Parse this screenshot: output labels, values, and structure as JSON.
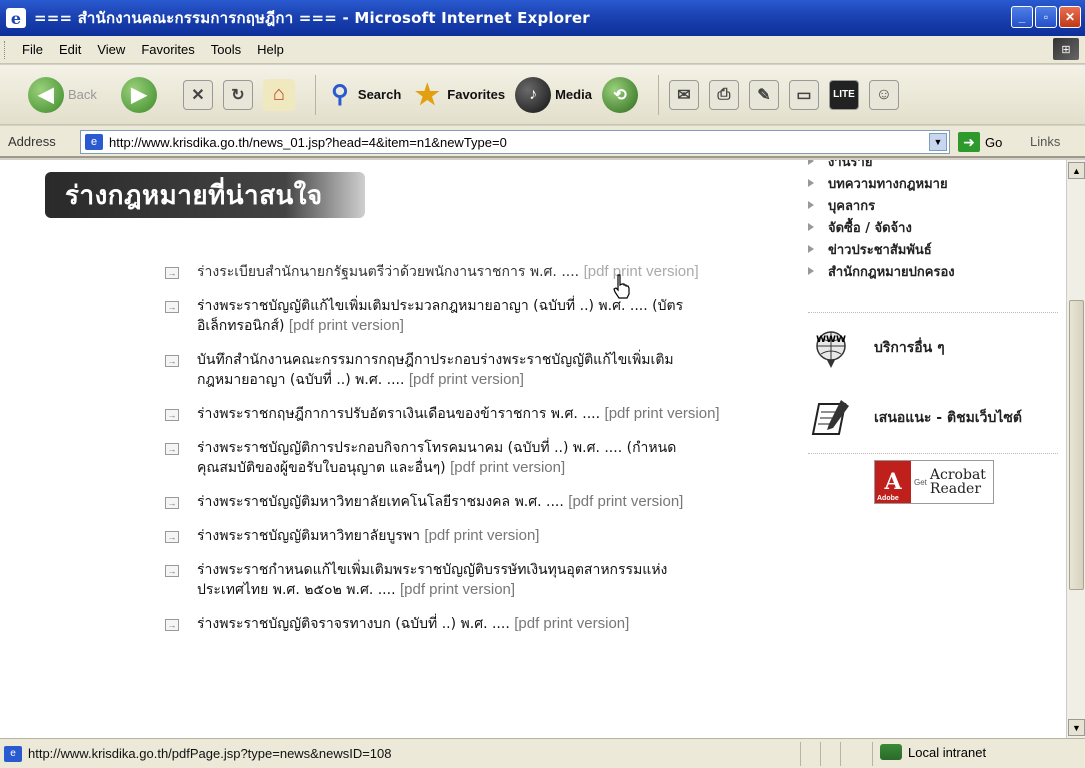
{
  "window": {
    "title": "=== สำนักงานคณะกรรมการกฤษฎีกา === - Microsoft Internet Explorer",
    "minimize": "_",
    "maximize": "▫",
    "close": "✕"
  },
  "menu": [
    "File",
    "Edit",
    "View",
    "Favorites",
    "Tools",
    "Help"
  ],
  "toolbar": {
    "back": "Back",
    "search": "Search",
    "favorites": "Favorites",
    "media": "Media"
  },
  "address": {
    "label": "Address",
    "url": "http://www.krisdika.go.th/news_01.jsp?head=4&item=n1&newType=0",
    "go": "Go",
    "links": "Links"
  },
  "page": {
    "heading": "ร่างกฎหมายที่น่าสนใจ",
    "articles": [
      {
        "text": "ร่างระเบียบสำนักนายกรัฐมนตรีว่าด้วยพนักงานราชการ พ.ศ. ....",
        "pdf": "[pdf print version]"
      },
      {
        "text": "ร่างพระราชบัญญัติแก้ไขเพิ่มเติมประมวลกฎหมายอาญา (ฉบับที่ ..) พ.ศ. .... (บัตรอิเล็กทรอนิกส์)",
        "pdf": "[pdf print version]"
      },
      {
        "text": "บันทึกสำนักงานคณะกรรมการกฤษฎีกาประกอบร่างพระราชบัญญัติแก้ไขเพิ่มเติมกฎหมายอาญา (ฉบับที่ ..) พ.ศ. ....",
        "pdf": "[pdf print version]"
      },
      {
        "text": "ร่างพระราชกฤษฎีกาการปรับอัตราเงินเดือนของข้าราชการ พ.ศ. ....",
        "pdf": "[pdf print version]"
      },
      {
        "text": "ร่างพระราชบัญญัติการประกอบกิจการโทรคมนาคม (ฉบับที่ ..) พ.ศ. .... (กำหนดคุณสมบัติของผู้ขอรับใบอนุญาต และอื่นๆ)",
        "pdf": "[pdf print version]"
      },
      {
        "text": "ร่างพระราชบัญญัติมหาวิทยาลัยเทคโนโลยีราชมงคล พ.ศ. ....",
        "pdf": "[pdf print version]"
      },
      {
        "text": "ร่างพระราชบัญญัติมหาวิทยาลัยบูรพา",
        "pdf": "[pdf print version]"
      },
      {
        "text": "ร่างพระราชกำหนดแก้ไขเพิ่มเติมพระราชบัญญัติบรรษัทเงินทุนอุตสาหกรรมแห่งประเทศไทย พ.ศ. ๒๕๐๒ พ.ศ. ....",
        "pdf": "[pdf print version]"
      },
      {
        "text": "ร่างพระราชบัญญัติจราจรทางบก (ฉบับที่ ..) พ.ศ. ....",
        "pdf": "[pdf print version]"
      }
    ]
  },
  "sidebar": {
    "links": [
      "งานราย",
      "บทความทางกฎหมาย",
      "บุคลากร",
      "จัดซื้อ / จัดจ้าง",
      "ข่าวประชาสัมพันธ์",
      "สำนักกฎหมายปกครอง"
    ],
    "services": [
      {
        "label": "บริการอื่น ๆ",
        "icon": "www-icon"
      },
      {
        "label": "เสนอแนะ - ติชมเว็บไซต์",
        "icon": "notepad-icon"
      }
    ],
    "acrobat": {
      "get": "Get",
      "name1": "Acrobat",
      "name2": "Reader",
      "brand": "Adobe"
    }
  },
  "status": {
    "url": "http://www.krisdika.go.th/pdfPage.jsp?type=news&newsID=108",
    "zone": "Local intranet"
  },
  "colors": {
    "titlebar": "#1c44b4",
    "banner": "#333333",
    "accent_green": "#2e9a2e"
  }
}
